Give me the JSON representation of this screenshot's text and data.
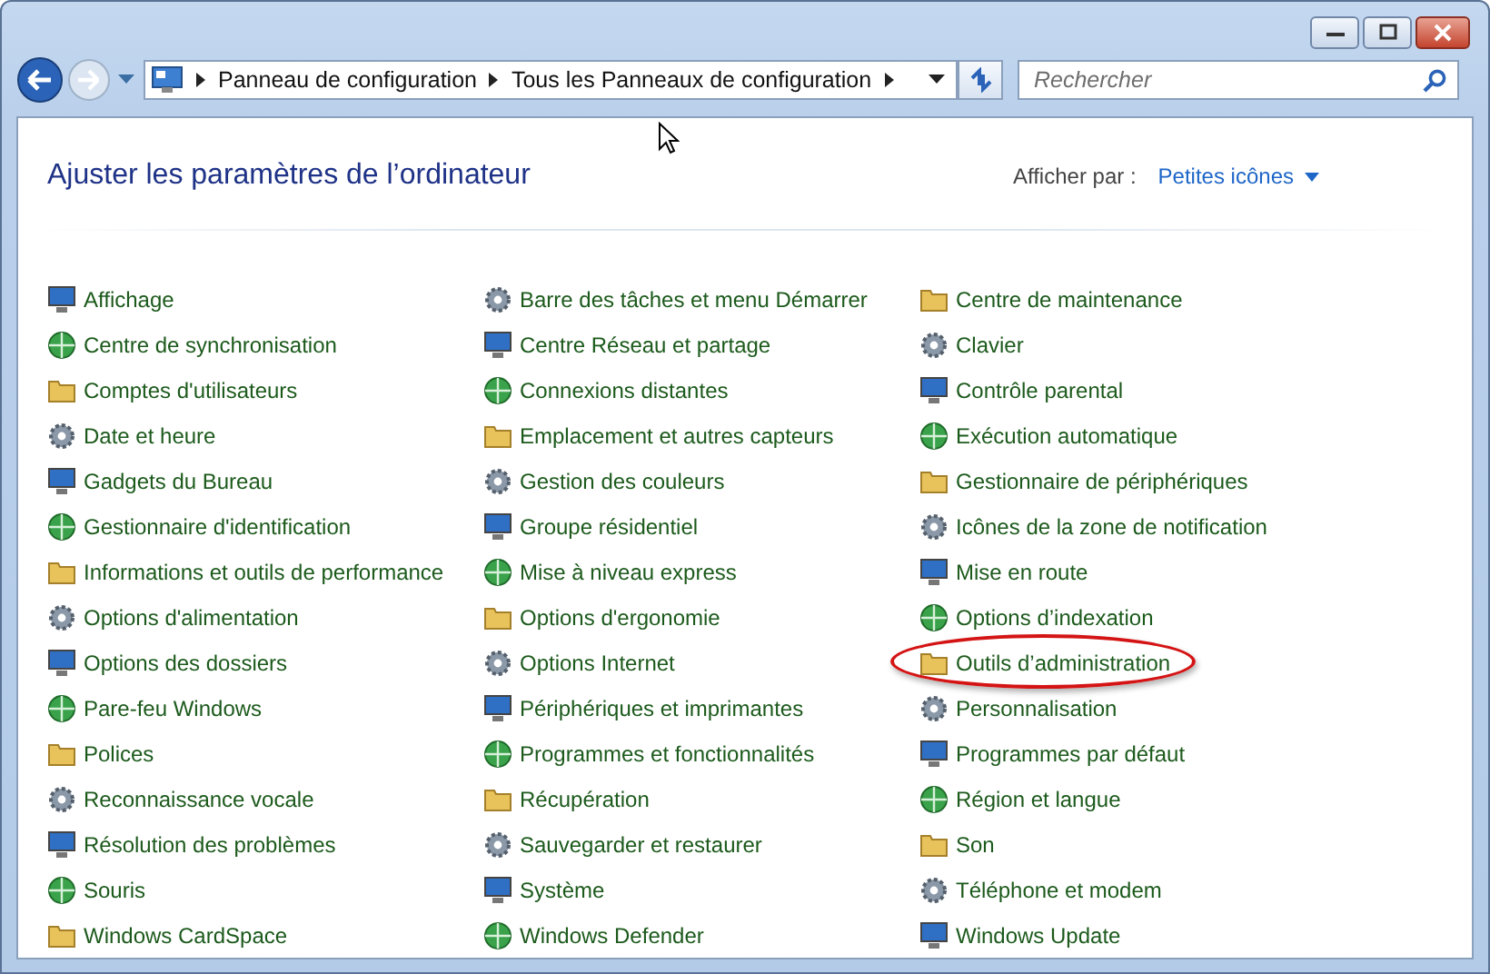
{
  "address_bar": {
    "crumbs": [
      "Panneau de configuration",
      "Tous les Panneaux de configuration"
    ]
  },
  "search": {
    "placeholder": "Rechercher"
  },
  "header": {
    "title": "Ajuster les paramètres de l’ordinateur",
    "view_label": "Afficher par :",
    "view_value": "Petites icônes"
  },
  "columns": [
    [
      {
        "label": "Affichage",
        "highlighted": false
      },
      {
        "label": "Centre de synchronisation",
        "highlighted": false
      },
      {
        "label": "Comptes d'utilisateurs",
        "highlighted": false
      },
      {
        "label": "Date et heure",
        "highlighted": false
      },
      {
        "label": "Gadgets du Bureau",
        "highlighted": false
      },
      {
        "label": "Gestionnaire d'identification",
        "highlighted": false
      },
      {
        "label": "Informations et outils de performance",
        "highlighted": false
      },
      {
        "label": "Options d'alimentation",
        "highlighted": false
      },
      {
        "label": "Options des dossiers",
        "highlighted": false
      },
      {
        "label": "Pare-feu Windows",
        "highlighted": false
      },
      {
        "label": "Polices",
        "highlighted": false
      },
      {
        "label": "Reconnaissance vocale",
        "highlighted": false
      },
      {
        "label": "Résolution des problèmes",
        "highlighted": false
      },
      {
        "label": "Souris",
        "highlighted": false
      },
      {
        "label": "Windows CardSpace",
        "highlighted": false
      }
    ],
    [
      {
        "label": "Barre des tâches et menu Démarrer",
        "highlighted": false
      },
      {
        "label": "Centre Réseau et partage",
        "highlighted": false
      },
      {
        "label": "Connexions distantes",
        "highlighted": false
      },
      {
        "label": "Emplacement et autres capteurs",
        "highlighted": false
      },
      {
        "label": "Gestion des couleurs",
        "highlighted": false
      },
      {
        "label": "Groupe résidentiel",
        "highlighted": false
      },
      {
        "label": "Mise à niveau express",
        "highlighted": false
      },
      {
        "label": "Options d'ergonomie",
        "highlighted": false
      },
      {
        "label": "Options Internet",
        "highlighted": false
      },
      {
        "label": "Périphériques et imprimantes",
        "highlighted": false
      },
      {
        "label": "Programmes et fonctionnalités",
        "highlighted": false
      },
      {
        "label": "Récupération",
        "highlighted": false
      },
      {
        "label": "Sauvegarder et restaurer",
        "highlighted": false
      },
      {
        "label": "Système",
        "highlighted": false
      },
      {
        "label": "Windows Defender",
        "highlighted": false
      }
    ],
    [
      {
        "label": "Centre de maintenance",
        "highlighted": false
      },
      {
        "label": "Clavier",
        "highlighted": false
      },
      {
        "label": "Contrôle parental",
        "highlighted": false
      },
      {
        "label": "Exécution automatique",
        "highlighted": false
      },
      {
        "label": "Gestionnaire de périphériques",
        "highlighted": false
      },
      {
        "label": "Icônes de la zone de notification",
        "highlighted": false
      },
      {
        "label": "Mise en route",
        "highlighted": false
      },
      {
        "label": "Options d’indexation",
        "highlighted": false
      },
      {
        "label": "Outils d’administration",
        "highlighted": true
      },
      {
        "label": "Personnalisation",
        "highlighted": false
      },
      {
        "label": "Programmes par défaut",
        "highlighted": false
      },
      {
        "label": "Région et langue",
        "highlighted": false
      },
      {
        "label": "Son",
        "highlighted": false
      },
      {
        "label": "Téléphone et modem",
        "highlighted": false
      },
      {
        "label": "Windows Update",
        "highlighted": false
      }
    ]
  ]
}
